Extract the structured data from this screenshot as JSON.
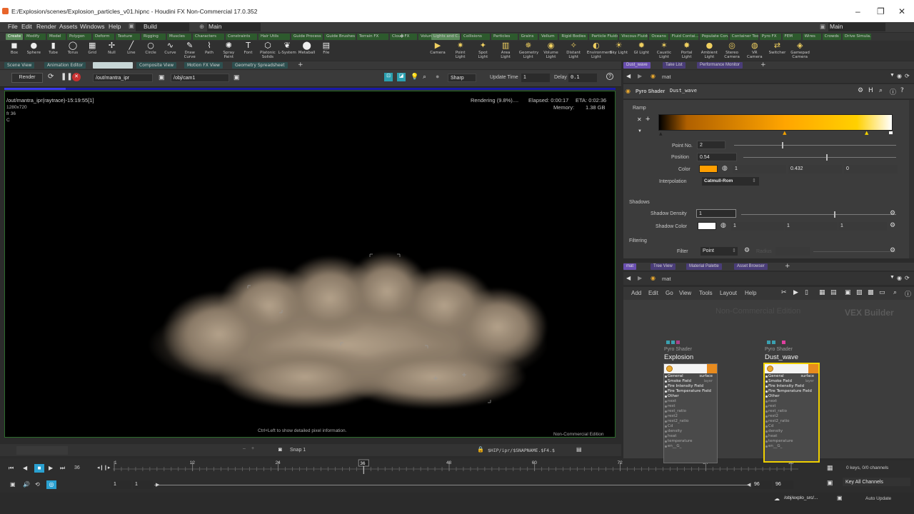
{
  "window": {
    "title": "E:/Explosion/scenes/Explosion_particles_v01.hipnc - Houdini FX Non-Commercial 17.0.352"
  },
  "menu": {
    "items": [
      "File",
      "Edit",
      "Render",
      "Assets",
      "Windows",
      "Help"
    ],
    "desktop": "Build",
    "main": "Main",
    "main_right": "Main"
  },
  "shelf_tabs_left": [
    "Create",
    "Modify",
    "Model",
    "Polygon",
    "Deform",
    "Texture",
    "Rigging",
    "Muscles",
    "Characters",
    "Constraints",
    "Hair Utils",
    "Guide Process",
    "Guide Brushes",
    "Terrain FX",
    "Cloud FX",
    "Volume"
  ],
  "shelf_tabs_right": [
    "Lights and C...",
    "Collisions",
    "Particles",
    "Grains",
    "Vellum",
    "Rigid Bodies",
    "Particle Fluids",
    "Viscous Fluids",
    "Oceans",
    "Fluid Contai...",
    "Populate Con...",
    "Container Tools",
    "Pyro FX",
    "FEM",
    "Wires",
    "Crowds",
    "Drive Simula..."
  ],
  "tools_left": [
    {
      "label": "Box",
      "glyph": "◼"
    },
    {
      "label": "Sphere",
      "glyph": "●"
    },
    {
      "label": "Tube",
      "glyph": "▮"
    },
    {
      "label": "Torus",
      "glyph": "◯"
    },
    {
      "label": "Grid",
      "glyph": "▦"
    },
    {
      "label": "Null",
      "glyph": "✢"
    },
    {
      "label": "Line",
      "glyph": "╱"
    },
    {
      "label": "Circle",
      "glyph": "○"
    },
    {
      "label": "Curve",
      "glyph": "∿"
    },
    {
      "label": "Draw Curve",
      "glyph": "✎"
    },
    {
      "label": "Path",
      "glyph": "⌇"
    },
    {
      "label": "Spray Paint",
      "glyph": "✺"
    },
    {
      "label": "Font",
      "glyph": "T"
    },
    {
      "label": "Platonic Solids",
      "glyph": "⬡"
    },
    {
      "label": "L-System",
      "glyph": "❦"
    },
    {
      "label": "Metaball",
      "glyph": "⬤"
    },
    {
      "label": "File",
      "glyph": "▤"
    }
  ],
  "tools_right": [
    {
      "label": "Camera",
      "glyph": "▶"
    },
    {
      "label": "Point Light",
      "glyph": "✷"
    },
    {
      "label": "Spot Light",
      "glyph": "✦"
    },
    {
      "label": "Area Light",
      "glyph": "▥"
    },
    {
      "label": "Geometry Light",
      "glyph": "✵"
    },
    {
      "label": "Volume Light",
      "glyph": "◉"
    },
    {
      "label": "Distant Light",
      "glyph": "✧"
    },
    {
      "label": "Environment Light",
      "glyph": "◐"
    },
    {
      "label": "Sky Light",
      "glyph": "☀"
    },
    {
      "label": "GI Light",
      "glyph": "✹"
    },
    {
      "label": "Caustic Light",
      "glyph": "✶"
    },
    {
      "label": "Portal Light",
      "glyph": "✸"
    },
    {
      "label": "Ambient Light",
      "glyph": "●"
    },
    {
      "label": "Stereo Camera",
      "glyph": "◎"
    },
    {
      "label": "VR Camera",
      "glyph": "◍"
    },
    {
      "label": "Switcher",
      "glyph": "⇄"
    },
    {
      "label": "Gamepad Camera",
      "glyph": "◈"
    }
  ],
  "left_pane_tabs": [
    "Scene View",
    "Animation Editor",
    "Render View",
    "Composite View",
    "Motion FX View",
    "Geometry Spreadsheet"
  ],
  "render_toolbar": {
    "render_label": "Render",
    "output": "/out/mantra_ipr",
    "camera": "/obj/cam1",
    "mode": "Sharp",
    "update_time_label": "Update Time",
    "update_time_value": "1",
    "delay_label": "Delay",
    "delay_value": "0.1"
  },
  "viewport": {
    "info_line": "/out/mantra_ipr(raytrace)-15:19:55[1]",
    "res": "1280x720",
    "frame": "fr 36",
    "channel": "C",
    "rendering": "Rendering (9.8%)....",
    "elapsed": "Elapsed: 0:00:17",
    "eta": "ETA: 0:02:36",
    "memory_label": "Memory:",
    "memory_value": "1.38 GB",
    "hint": "Ctrl+Left to show detailed pixel information.",
    "edition": "Non-Commercial Edition"
  },
  "viewport_bottom": {
    "snap": "Snap 1",
    "path": "$HIP/ipr/$SNAPNAME.$F4.$"
  },
  "timeline": {
    "ticks": [
      "1",
      "12",
      "24",
      "36",
      "48",
      "60",
      "72",
      "84",
      "96"
    ],
    "tick_values": [
      1,
      12,
      24,
      36,
      48,
      60,
      72,
      84,
      96
    ],
    "current_frame": "36",
    "current_value": 36,
    "range_start": 1,
    "range_end": 96,
    "start": "1",
    "start2": "1",
    "end": "96",
    "end2": "96"
  },
  "right_status": {
    "keys": "0 keys, 0/0 channels",
    "key_all": "Key All Channels",
    "auto_update": "Auto Update",
    "path": "/obj/explo_src/..."
  },
  "right_top_tabs": [
    "Dust_wave",
    "Take List",
    "Performance Monitor"
  ],
  "right_path": "mat",
  "parm": {
    "node_type": "Pyro Shader",
    "node_name": "Dust_wave",
    "ramp_label": "Ramp",
    "point_no_label": "Point No.",
    "point_no": "2",
    "position_label": "Position",
    "position": "0.54",
    "position_fraction": 0.54,
    "color_label": "Color",
    "color_r": "1",
    "color_g": "0.432",
    "color_b": "0",
    "color_hex": "#ff9f00",
    "interp_label": "Interpolation",
    "interp": "Catmull-Rom",
    "shadows_label": "Shadows",
    "shadow_density_label": "Shadow Density",
    "shadow_density": "1",
    "shadow_density_fraction": 0.6,
    "shadow_color_label": "Shadow Color",
    "shadow_color_r": "1",
    "shadow_color_g": "1",
    "shadow_color_b": "1",
    "filtering_label": "Filtering",
    "filter_label": "Filter",
    "filter": "Point",
    "filter_extra": "Radius"
  },
  "right_bottom_tabs": [
    "mat",
    "Tree View",
    "Material Palette",
    "Asset Browser"
  ],
  "net_menu": [
    "Add",
    "Edit",
    "Go",
    "View",
    "Tools",
    "Layout",
    "Help"
  ],
  "net": {
    "watermark": "Non-Commercial Edition",
    "context": "VEX Builder"
  },
  "nodes": [
    {
      "type": "Pyro Shader",
      "name": "Explosion"
    },
    {
      "type": "Pyro Shader",
      "name": "Dust_wave"
    }
  ],
  "node_header_right": [
    "surface",
    "layer"
  ],
  "node_inputs_bright": [
    "General",
    "Smoke Field",
    "Fire Intensity Field",
    "Fire Temperature Field",
    "Other"
  ],
  "node_inputs_dim": [
    "next",
    "rest",
    "rest_ratio",
    "rest2",
    "rest2_ratio",
    "Cd",
    "density",
    "heat",
    "temperature",
    "en__G_"
  ],
  "colors": {
    "accent": "#6a4fb0",
    "ramp_start": "#000000",
    "ramp_mid": "#ffa500",
    "ramp_end": "#ffffff",
    "select": "#f0d000"
  }
}
